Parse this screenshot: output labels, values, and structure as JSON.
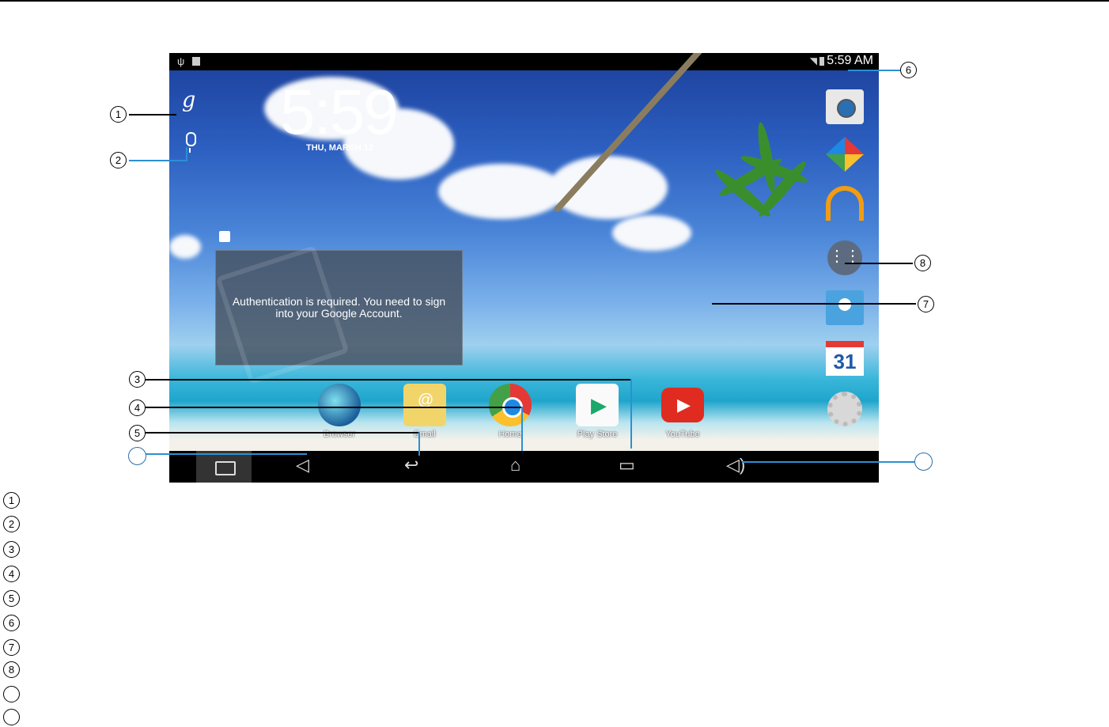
{
  "status_bar": {
    "time": "5:59 AM"
  },
  "home": {
    "google_glyph": "g",
    "clock": "5:59",
    "date": "THU, MARCH 12",
    "auth_message": "Authentication is required. You need to sign into your Google Account."
  },
  "dock_apps": [
    {
      "label": "Browser",
      "icon": "globe-icon"
    },
    {
      "label": "Email",
      "icon": "email-icon"
    },
    {
      "label": "Home",
      "icon": "chrome-icon"
    },
    {
      "label": "Play Store",
      "icon": "play-store-icon"
    },
    {
      "label": "YouTube",
      "icon": "youtube-icon"
    }
  ],
  "right_apps": [
    "camera-icon",
    "photos-pinwheel-icon",
    "music-headphones-icon",
    "app-drawer-icon",
    "contacts-icon",
    "calendar-icon",
    "settings-gear-icon"
  ],
  "calendar_day": "31",
  "callouts": [
    "1",
    "2",
    "3",
    "4",
    "5",
    "6",
    "7",
    "8"
  ],
  "legend_markers": [
    "1",
    "2",
    "3",
    "4",
    "5",
    "6",
    "7",
    "8"
  ],
  "colors": {
    "callout_line": "#2c8fd3",
    "nav_bar": "#000000",
    "status_bar": "#000000"
  }
}
